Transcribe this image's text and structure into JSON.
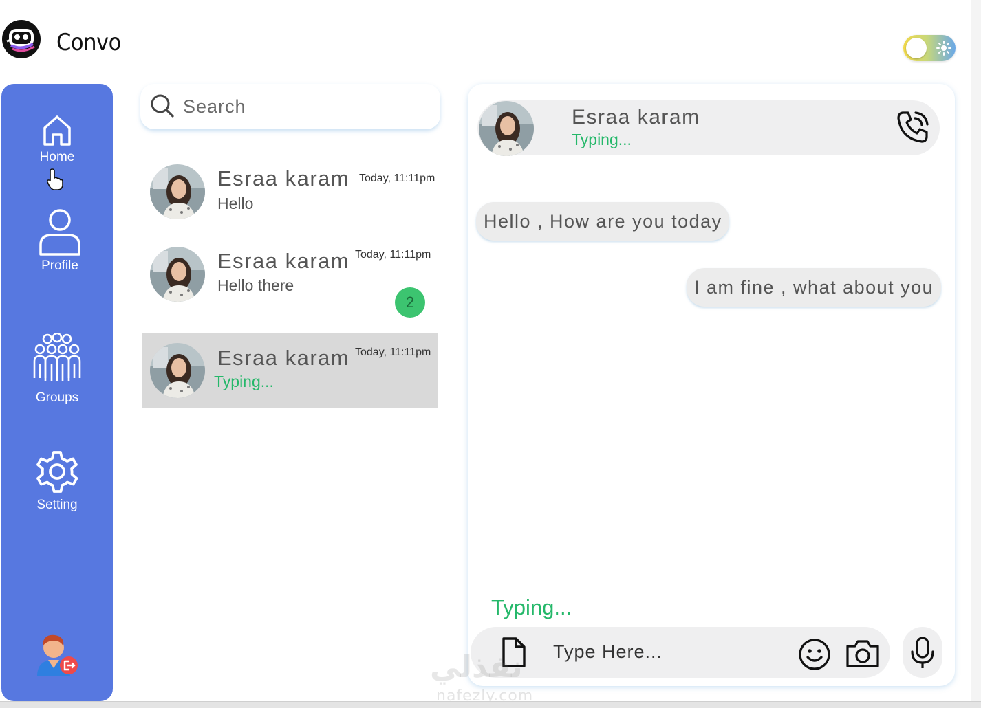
{
  "app": {
    "title": "Convo",
    "logo_icon": "robot-logo-icon",
    "theme_toggle_icon": "sun-icon"
  },
  "sidebar": {
    "items": [
      {
        "label": "Home",
        "icon": "home-icon"
      },
      {
        "label": "Profile",
        "icon": "user-icon"
      },
      {
        "label": "Groups",
        "icon": "group-icon"
      },
      {
        "label": "Setting",
        "icon": "gear-icon"
      }
    ],
    "logout_icon": "user-logout-icon"
  },
  "search": {
    "placeholder": "Search"
  },
  "chats": [
    {
      "name": "Esraa karam",
      "time": "Today, 11:11pm",
      "preview": "Hello",
      "unread": null,
      "typing": false
    },
    {
      "name": "Esraa karam",
      "time": "Today, 11:11pm",
      "preview": "Hello there",
      "unread": "2",
      "typing": false
    },
    {
      "name": "Esraa karam",
      "time": "Today, 11:11pm",
      "preview": "Typing...",
      "unread": null,
      "typing": true
    }
  ],
  "conversation": {
    "name": "Esraa karam",
    "status": "Typing...",
    "messages": [
      {
        "direction": "in",
        "text": "Hello , How are you today"
      },
      {
        "direction": "out",
        "text": "I am fine , what about you"
      }
    ],
    "typing_indicator": "Typing...",
    "composer_placeholder": "Type Here..."
  },
  "colors": {
    "sidebar": "#5778e0",
    "accent_green": "#25b86a",
    "badge": "#3cc470"
  },
  "watermark": {
    "line1": "نفذلي",
    "line2": "nafezly.com"
  }
}
